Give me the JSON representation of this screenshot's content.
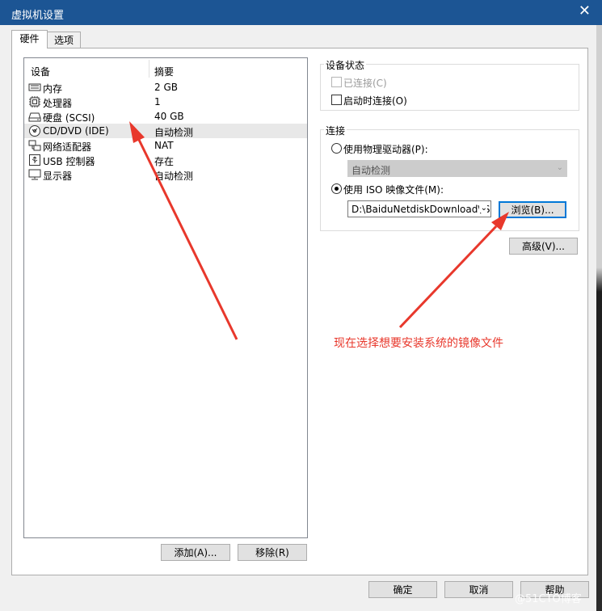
{
  "window": {
    "title": "虚拟机设置",
    "close_glyph": "✕"
  },
  "tabs": [
    {
      "label": "硬件"
    },
    {
      "label": "选项"
    }
  ],
  "device_list": {
    "col_device": "设备",
    "col_summary": "摘要",
    "rows": [
      {
        "name": "内存",
        "summary": "2 GB",
        "icon": "memory-icon"
      },
      {
        "name": "处理器",
        "summary": "1",
        "icon": "cpu-icon"
      },
      {
        "name": "硬盘 (SCSI)",
        "summary": "40 GB",
        "icon": "harddisk-icon"
      },
      {
        "name": "CD/DVD (IDE)",
        "summary": "自动检测",
        "icon": "cd-dvd-icon",
        "selected": true
      },
      {
        "name": "网络适配器",
        "summary": "NAT",
        "icon": "network-icon"
      },
      {
        "name": "USB 控制器",
        "summary": "存在",
        "icon": "usb-icon"
      },
      {
        "name": "显示器",
        "summary": "自动检测",
        "icon": "display-icon"
      }
    ]
  },
  "list_buttons": {
    "add": "添加(A)...",
    "remove": "移除(R)"
  },
  "device_status": {
    "title": "设备状态",
    "connected": "已连接(C)",
    "connect_at_power_on": "启动时连接(O)"
  },
  "connection": {
    "title": "连接",
    "physical_drive": "使用物理驱动器(P):",
    "physical_drive_value": "自动检测",
    "iso_file": "使用 ISO 映像文件(M):",
    "iso_path": "D:\\BaiduNetdiskDownload\\IS",
    "browse": "浏览(B)...",
    "advanced": "高级(V)..."
  },
  "dialog_buttons": {
    "ok": "确定",
    "cancel": "取消",
    "help": "帮助"
  },
  "annotation": {
    "text": "现在选择想要安装系统的镜像文件",
    "color": "#e8382c"
  },
  "watermark": "@51CTO博客"
}
